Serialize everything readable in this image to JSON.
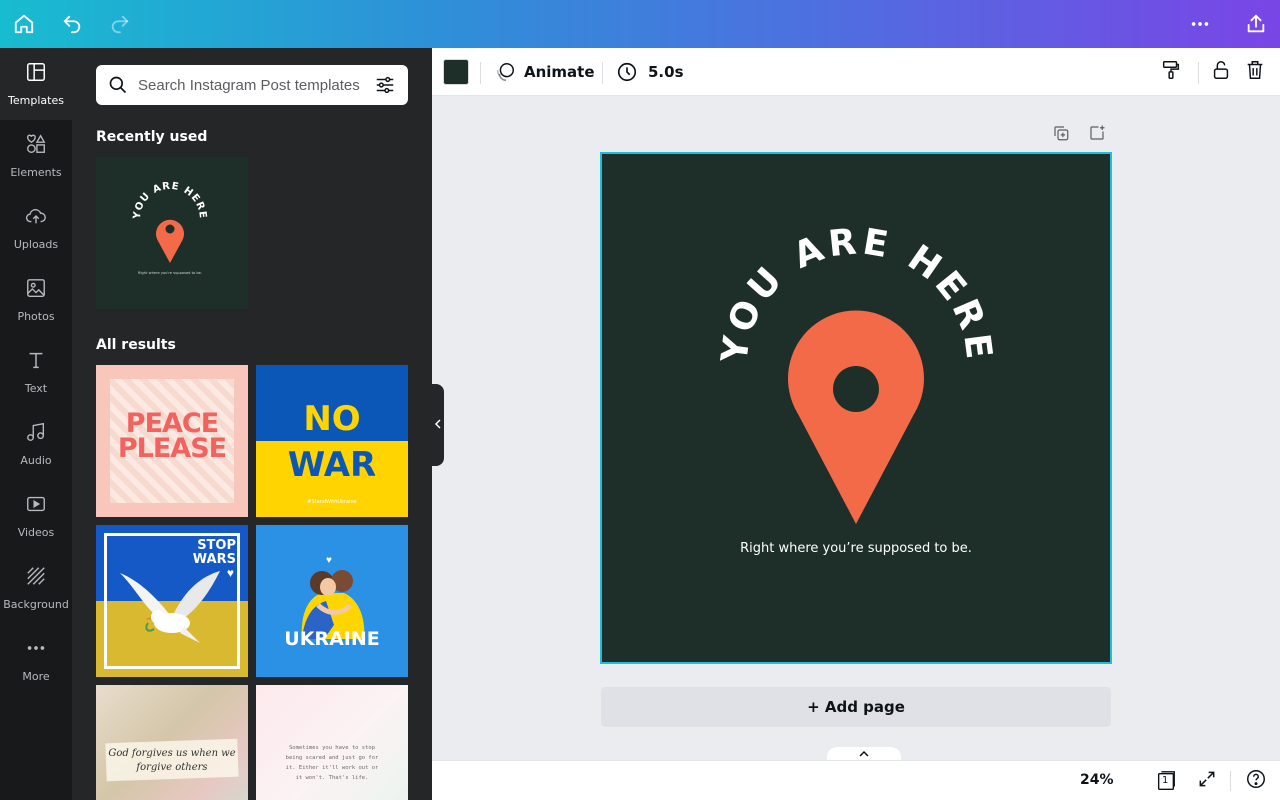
{
  "topbar": {
    "home_icon": "home-icon",
    "undo_icon": "undo-icon",
    "redo_icon": "redo-icon",
    "more_icon": "more-horizontal-icon",
    "share_icon": "share-icon"
  },
  "rail": {
    "items": [
      {
        "label": "Templates",
        "icon": "templates-icon",
        "active": true
      },
      {
        "label": "Elements",
        "icon": "elements-icon"
      },
      {
        "label": "Uploads",
        "icon": "uploads-icon"
      },
      {
        "label": "Photos",
        "icon": "photos-icon"
      },
      {
        "label": "Text",
        "icon": "text-icon"
      },
      {
        "label": "Audio",
        "icon": "audio-icon"
      },
      {
        "label": "Videos",
        "icon": "videos-icon"
      },
      {
        "label": "Background",
        "icon": "background-icon"
      },
      {
        "label": "More",
        "icon": "more-icon"
      }
    ]
  },
  "panel": {
    "search_placeholder": "Search Instagram Post templates",
    "recently_used_title": "Recently used",
    "all_results_title": "All results",
    "recent_thumb": {
      "headline": "YOU ARE HERE",
      "tagline": "Right where you're supposed to be."
    },
    "results": [
      {
        "text": "PEACE PLEASE",
        "line1": "PEACE",
        "line2": "PLEASE"
      },
      {
        "text": "NO WAR",
        "line1": "NO",
        "line2": "WAR",
        "tag": "#StandWithUkraine"
      },
      {
        "text": "STOP WARS",
        "line1": "STOP",
        "line2": "WARS"
      },
      {
        "text": "UKRAINE"
      },
      {
        "text": "God forgives us when we forgive others",
        "line1": "God forgives us when we",
        "line2": "forgive others"
      },
      {
        "text": "Sometimes you have to stop being scared and just go for it. Either it'll work out or it won't. That's life.",
        "line1": "Sometimes you have to stop",
        "line2": "being scared and just go for",
        "line3": "it. Either it'll work out or",
        "line4": "it won't. That's life."
      }
    ]
  },
  "toolbar": {
    "color_swatch": "#1e2f29",
    "animate_label": "Animate",
    "duration_label": "5.0s"
  },
  "canvas": {
    "headline": "YOU ARE HERE",
    "tagline": "Right where you’re supposed to be.",
    "background": "#1e2f29",
    "pin_color": "#f26a47"
  },
  "add_page_label": "+ Add page",
  "bottombar": {
    "zoom": "24%",
    "page_count": "1"
  }
}
